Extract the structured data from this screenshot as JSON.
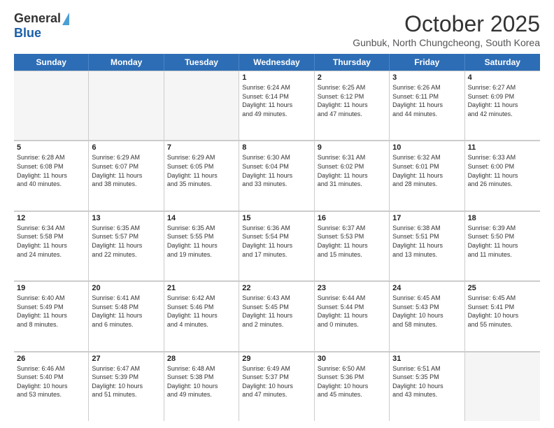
{
  "logo": {
    "general": "General",
    "blue": "Blue"
  },
  "header": {
    "month": "October 2025",
    "location": "Gunbuk, North Chungcheong, South Korea"
  },
  "days": [
    "Sunday",
    "Monday",
    "Tuesday",
    "Wednesday",
    "Thursday",
    "Friday",
    "Saturday"
  ],
  "weeks": [
    [
      {
        "day": "",
        "info": ""
      },
      {
        "day": "",
        "info": ""
      },
      {
        "day": "",
        "info": ""
      },
      {
        "day": "1",
        "info": "Sunrise: 6:24 AM\nSunset: 6:14 PM\nDaylight: 11 hours\nand 49 minutes."
      },
      {
        "day": "2",
        "info": "Sunrise: 6:25 AM\nSunset: 6:12 PM\nDaylight: 11 hours\nand 47 minutes."
      },
      {
        "day": "3",
        "info": "Sunrise: 6:26 AM\nSunset: 6:11 PM\nDaylight: 11 hours\nand 44 minutes."
      },
      {
        "day": "4",
        "info": "Sunrise: 6:27 AM\nSunset: 6:09 PM\nDaylight: 11 hours\nand 42 minutes."
      }
    ],
    [
      {
        "day": "5",
        "info": "Sunrise: 6:28 AM\nSunset: 6:08 PM\nDaylight: 11 hours\nand 40 minutes."
      },
      {
        "day": "6",
        "info": "Sunrise: 6:29 AM\nSunset: 6:07 PM\nDaylight: 11 hours\nand 38 minutes."
      },
      {
        "day": "7",
        "info": "Sunrise: 6:29 AM\nSunset: 6:05 PM\nDaylight: 11 hours\nand 35 minutes."
      },
      {
        "day": "8",
        "info": "Sunrise: 6:30 AM\nSunset: 6:04 PM\nDaylight: 11 hours\nand 33 minutes."
      },
      {
        "day": "9",
        "info": "Sunrise: 6:31 AM\nSunset: 6:02 PM\nDaylight: 11 hours\nand 31 minutes."
      },
      {
        "day": "10",
        "info": "Sunrise: 6:32 AM\nSunset: 6:01 PM\nDaylight: 11 hours\nand 28 minutes."
      },
      {
        "day": "11",
        "info": "Sunrise: 6:33 AM\nSunset: 6:00 PM\nDaylight: 11 hours\nand 26 minutes."
      }
    ],
    [
      {
        "day": "12",
        "info": "Sunrise: 6:34 AM\nSunset: 5:58 PM\nDaylight: 11 hours\nand 24 minutes."
      },
      {
        "day": "13",
        "info": "Sunrise: 6:35 AM\nSunset: 5:57 PM\nDaylight: 11 hours\nand 22 minutes."
      },
      {
        "day": "14",
        "info": "Sunrise: 6:35 AM\nSunset: 5:55 PM\nDaylight: 11 hours\nand 19 minutes."
      },
      {
        "day": "15",
        "info": "Sunrise: 6:36 AM\nSunset: 5:54 PM\nDaylight: 11 hours\nand 17 minutes."
      },
      {
        "day": "16",
        "info": "Sunrise: 6:37 AM\nSunset: 5:53 PM\nDaylight: 11 hours\nand 15 minutes."
      },
      {
        "day": "17",
        "info": "Sunrise: 6:38 AM\nSunset: 5:51 PM\nDaylight: 11 hours\nand 13 minutes."
      },
      {
        "day": "18",
        "info": "Sunrise: 6:39 AM\nSunset: 5:50 PM\nDaylight: 11 hours\nand 11 minutes."
      }
    ],
    [
      {
        "day": "19",
        "info": "Sunrise: 6:40 AM\nSunset: 5:49 PM\nDaylight: 11 hours\nand 8 minutes."
      },
      {
        "day": "20",
        "info": "Sunrise: 6:41 AM\nSunset: 5:48 PM\nDaylight: 11 hours\nand 6 minutes."
      },
      {
        "day": "21",
        "info": "Sunrise: 6:42 AM\nSunset: 5:46 PM\nDaylight: 11 hours\nand 4 minutes."
      },
      {
        "day": "22",
        "info": "Sunrise: 6:43 AM\nSunset: 5:45 PM\nDaylight: 11 hours\nand 2 minutes."
      },
      {
        "day": "23",
        "info": "Sunrise: 6:44 AM\nSunset: 5:44 PM\nDaylight: 11 hours\nand 0 minutes."
      },
      {
        "day": "24",
        "info": "Sunrise: 6:45 AM\nSunset: 5:43 PM\nDaylight: 10 hours\nand 58 minutes."
      },
      {
        "day": "25",
        "info": "Sunrise: 6:45 AM\nSunset: 5:41 PM\nDaylight: 10 hours\nand 55 minutes."
      }
    ],
    [
      {
        "day": "26",
        "info": "Sunrise: 6:46 AM\nSunset: 5:40 PM\nDaylight: 10 hours\nand 53 minutes."
      },
      {
        "day": "27",
        "info": "Sunrise: 6:47 AM\nSunset: 5:39 PM\nDaylight: 10 hours\nand 51 minutes."
      },
      {
        "day": "28",
        "info": "Sunrise: 6:48 AM\nSunset: 5:38 PM\nDaylight: 10 hours\nand 49 minutes."
      },
      {
        "day": "29",
        "info": "Sunrise: 6:49 AM\nSunset: 5:37 PM\nDaylight: 10 hours\nand 47 minutes."
      },
      {
        "day": "30",
        "info": "Sunrise: 6:50 AM\nSunset: 5:36 PM\nDaylight: 10 hours\nand 45 minutes."
      },
      {
        "day": "31",
        "info": "Sunrise: 6:51 AM\nSunset: 5:35 PM\nDaylight: 10 hours\nand 43 minutes."
      },
      {
        "day": "",
        "info": ""
      }
    ]
  ]
}
